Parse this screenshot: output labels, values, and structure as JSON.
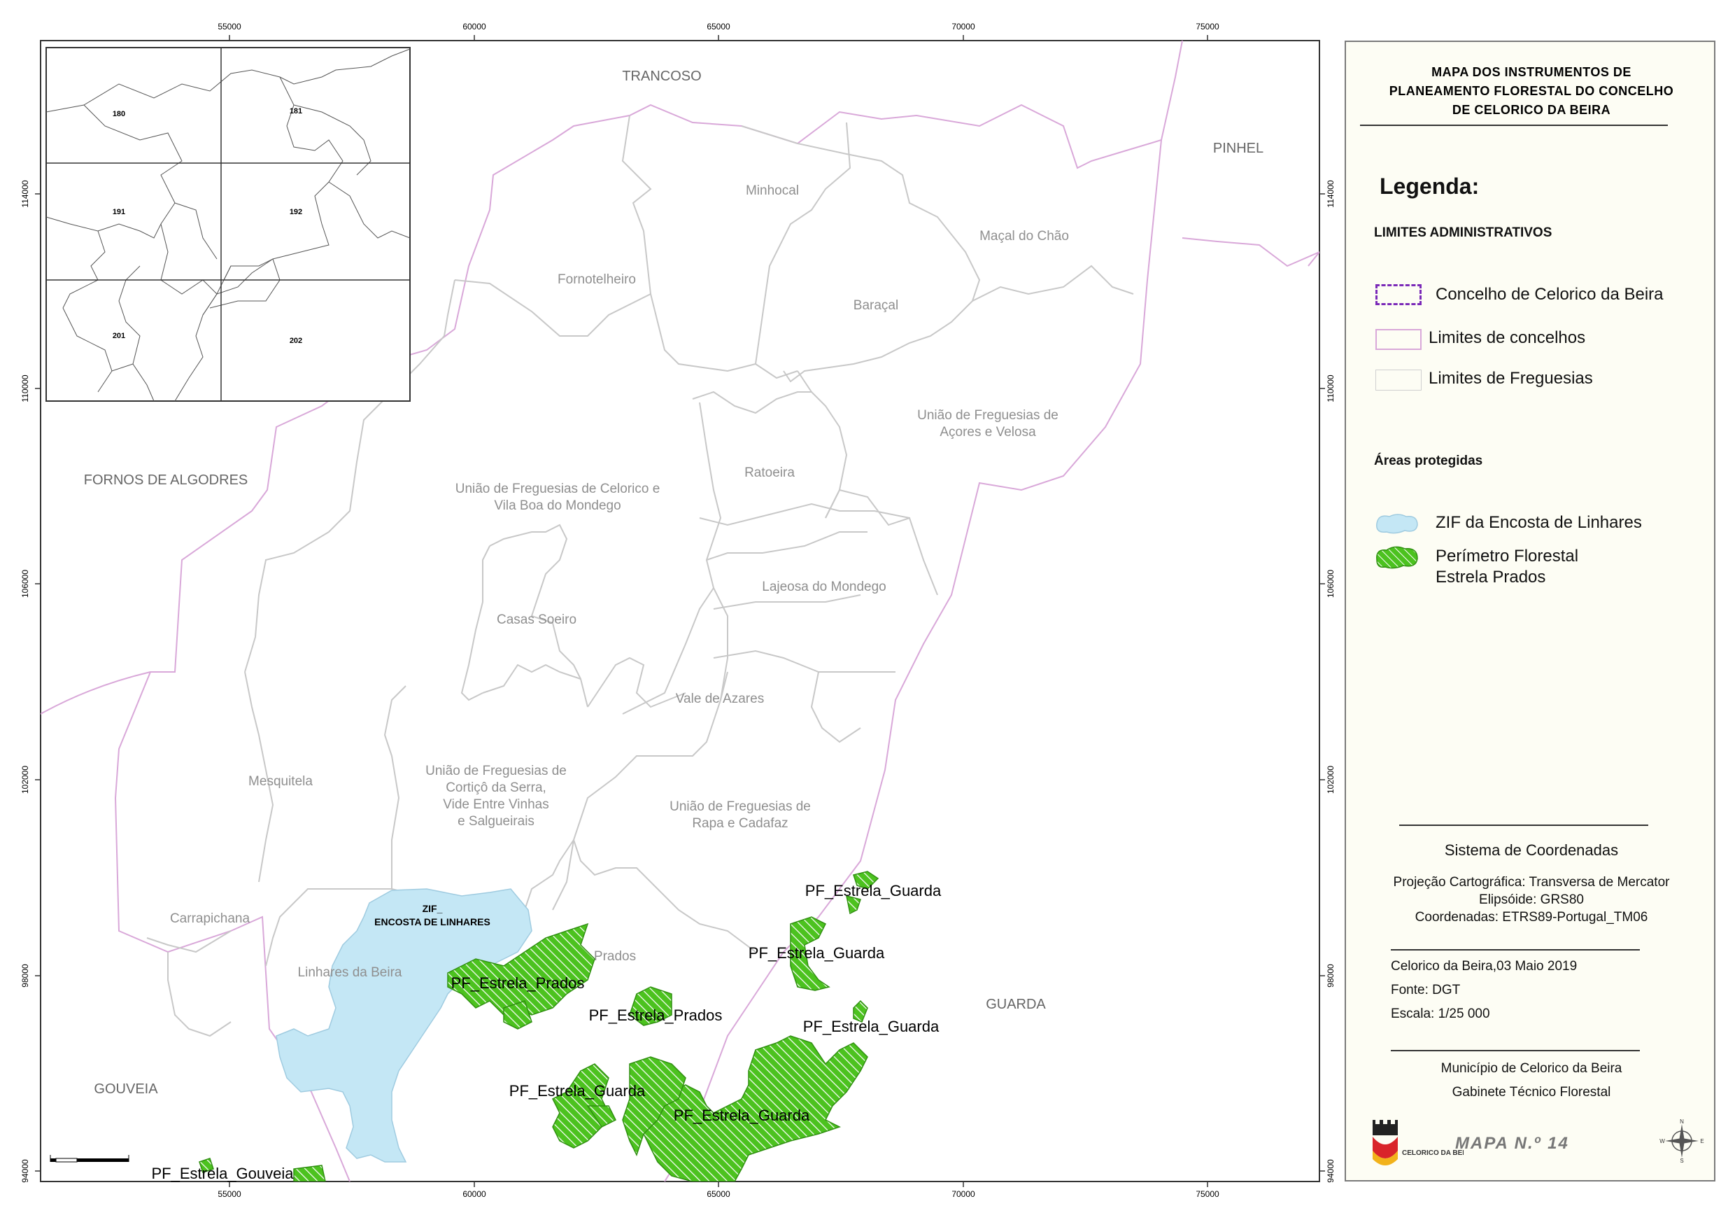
{
  "legend": {
    "title_lines": [
      "MAPA DOS INSTRUMENTOS DE",
      "PLANEAMENTO FLORESTAL DO CONCELHO",
      "DE CELORICO DA BEIRA"
    ],
    "heading": "Legenda:",
    "section_admin": "LIMITES ADMINISTRATIVOS",
    "concelho_celorico": "Concelho de Celorico da Beira",
    "limites_concelhos": "Limites de concelhos",
    "limites_freguesias": "Limites de Freguesias",
    "section_protected": "Áreas protegidas",
    "zif": "ZIF da Encosta de Linhares",
    "perimetro_line1": "Perímetro Florestal",
    "perimetro_line2": "Estrela Prados",
    "coord_title": "Sistema de Coordenadas",
    "projection": "Projeção Cartográfica: Transversa de Mercator",
    "ellipsoid": "Elipsóide: GRS80",
    "coordinates": "Coordenadas: ETRS89-Portugal_TM06",
    "date": "Celorico da Beira,03 Maio 2019",
    "source": "Fonte: DGT",
    "scale": "Escala: 1/25 000",
    "author_line1": "Município de Celorico da Beira",
    "author_line2": "Gabinete Técnico Florestal",
    "map_number": "MAPA N.º 14",
    "logo_text": "CELORICO DA BEIRA",
    "compass_n": "N",
    "compass_s": "S",
    "compass_e": "E",
    "compass_w": "W"
  },
  "colors": {
    "concelho": "#7b2ab8",
    "concelho_boundary": "#d9a8d9",
    "freguesia_boundary": "#c8c8c8",
    "zif_fill": "#c4e7f5",
    "forest_fill": "#4cc21f",
    "label": "#8f8f8f"
  },
  "grid": {
    "x_ticks": [
      "55000",
      "60000",
      "65000",
      "70000",
      "75000"
    ],
    "y_ticks": [
      "114000",
      "110000",
      "106000",
      "102000",
      "98000",
      "94000"
    ]
  },
  "inset": {
    "sheets": [
      "180",
      "181",
      "191",
      "192",
      "201",
      "202"
    ]
  },
  "concelhos": {
    "trancoso": "TRANCOSO",
    "pinhel": "PINHEL",
    "fornos": "FORNOS DE ALGODRES",
    "guarda": "GUARDA",
    "gouveia": "GOUVEIA"
  },
  "freguesias": {
    "minhocal": "Minhocal",
    "macal": "Maçal do Chão",
    "fornotelheiro": "Fornotelheiro",
    "baracal": "Baraçal",
    "acores_l1": "União de Freguesias de",
    "acores_l2": "Açores e Velosa",
    "ratoeira": "Ratoeira",
    "celorico_l1": "União de Freguesias de Celorico e",
    "celorico_l2": "Vila Boa do Mondego",
    "lajeosa": "Lajeosa do Mondego",
    "casas_soeiro": "Casas Soeiro",
    "vale_azares": "Vale de Azares",
    "mesquitela": "Mesquitela",
    "cortico_l1": "União de Freguesias de",
    "cortico_l2": "Cortiçô da Serra,",
    "cortico_l3": "Vide Entre Vinhas",
    "cortico_l4": "e Salgueirais",
    "rapa_l1": "União de Freguesias de",
    "rapa_l2": "Rapa e Cadafaz",
    "carrapichana": "Carrapichana",
    "linhares": "Linhares da Beira",
    "prados": "Prados"
  },
  "areas": {
    "zif_l1": "ZIF_",
    "zif_l2": "ENCOSTA DE LINHARES",
    "pf_guarda": "PF_Estrela_Guarda",
    "pf_prados": "PF_Estrela_Prados",
    "pf_gouveia": "PF_Estrela_Gouveia"
  }
}
